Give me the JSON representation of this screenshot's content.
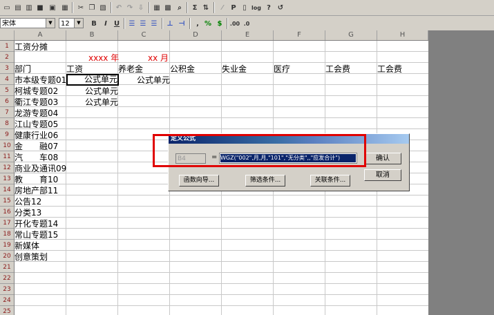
{
  "toolbar2": {
    "font_name": "宋体",
    "font_size": "12",
    "bold": "B",
    "italic": "I",
    "underline": "U",
    "percent": "%",
    "currency": "$",
    "comma": ",",
    "decimal": ".00"
  },
  "toolbar1": {
    "sigma": "Σ",
    "p": "P",
    "log": "log"
  },
  "columns": [
    "A",
    "B",
    "C",
    "D",
    "E",
    "F",
    "G",
    "H"
  ],
  "rows": [
    "1",
    "2",
    "3",
    "4",
    "5",
    "6",
    "7",
    "8",
    "9",
    "10",
    "11",
    "12",
    "13",
    "14",
    "15",
    "16",
    "17",
    "18",
    "19",
    "20",
    "21",
    "22",
    "23",
    "24",
    "25"
  ],
  "cells": {
    "a1": "工资分摊",
    "b2": "xxxx 年",
    "c2": "xx 月",
    "a3": "部门",
    "b3": "工资",
    "c3": "养老金",
    "d3": "公积金",
    "e3": "失业金",
    "f3": "医疗",
    "g3": "工会费",
    "h3": "工会费",
    "b4": "公式单元",
    "c4": "公式单元",
    "b5": "公式单元",
    "b6": "公式单元",
    "departments": [
      "市本级专题01",
      "柯城专题02",
      "衢江专题03",
      "龙游专题04",
      "江山专题05",
      "健康行业06",
      "金　　融07",
      "汽　　车08",
      "商业及通讯09",
      "教　　育10",
      "房地产部11",
      "公告12",
      "分类13",
      "开化专题14",
      "常山专题15",
      "新媒体",
      "创意策划"
    ]
  },
  "dialog": {
    "title": "定义公式",
    "cell_ref": "B4",
    "equals": "=",
    "formula": "WGZ(\"002\",月,月,\"101\",\"无分类\",,\"应发合计\")",
    "ok": "确认",
    "cancel": "取消",
    "func_wizard": "函数向导...",
    "filter": "筛选条件...",
    "relation": "关联条件..."
  }
}
